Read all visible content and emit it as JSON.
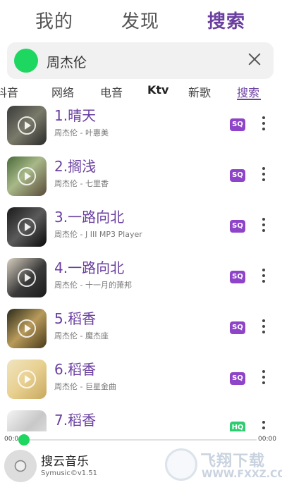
{
  "top_tabs": [
    {
      "label": "我的"
    },
    {
      "label": "发现"
    },
    {
      "label": "搜索",
      "active": true
    }
  ],
  "search": {
    "query": "周杰伦"
  },
  "source_tabs": [
    {
      "label": "抖音"
    },
    {
      "label": "网络"
    },
    {
      "label": "电音"
    },
    {
      "label": "Ktv"
    },
    {
      "label": "新歌"
    },
    {
      "label": "搜索",
      "active": true
    }
  ],
  "songs": [
    {
      "title": "1.晴天",
      "artist": "周杰伦 - 叶惠美",
      "quality": "SQ"
    },
    {
      "title": "2.搁浅",
      "artist": "周杰伦 - 七里香",
      "quality": "SQ"
    },
    {
      "title": "3.一路向北",
      "artist": "周杰伦 - J III MP3 Player",
      "quality": "SQ"
    },
    {
      "title": "4.一路向北",
      "artist": "周杰伦 - 十一月的萧邦",
      "quality": "SQ"
    },
    {
      "title": "5.稻香",
      "artist": "周杰伦 - 魔杰座",
      "quality": "SQ"
    },
    {
      "title": "6.稻香",
      "artist": "周杰伦 - 巨星金曲",
      "quality": "SQ"
    },
    {
      "title": "7.稻香",
      "artist": "",
      "quality": "HQ"
    }
  ],
  "player": {
    "current_time": "00:00",
    "total_time": "00:00",
    "progress": 0,
    "title": "搜云音乐",
    "version": "Symusic©v1.51"
  },
  "watermark": {
    "main": "飞翔下载",
    "sub": "WWW.FXXZ.COM"
  },
  "colors": {
    "accent": "#6a3fa0",
    "green": "#1ed760",
    "sq_badge": "#8e44c8",
    "hq_badge": "#2ecc71"
  }
}
